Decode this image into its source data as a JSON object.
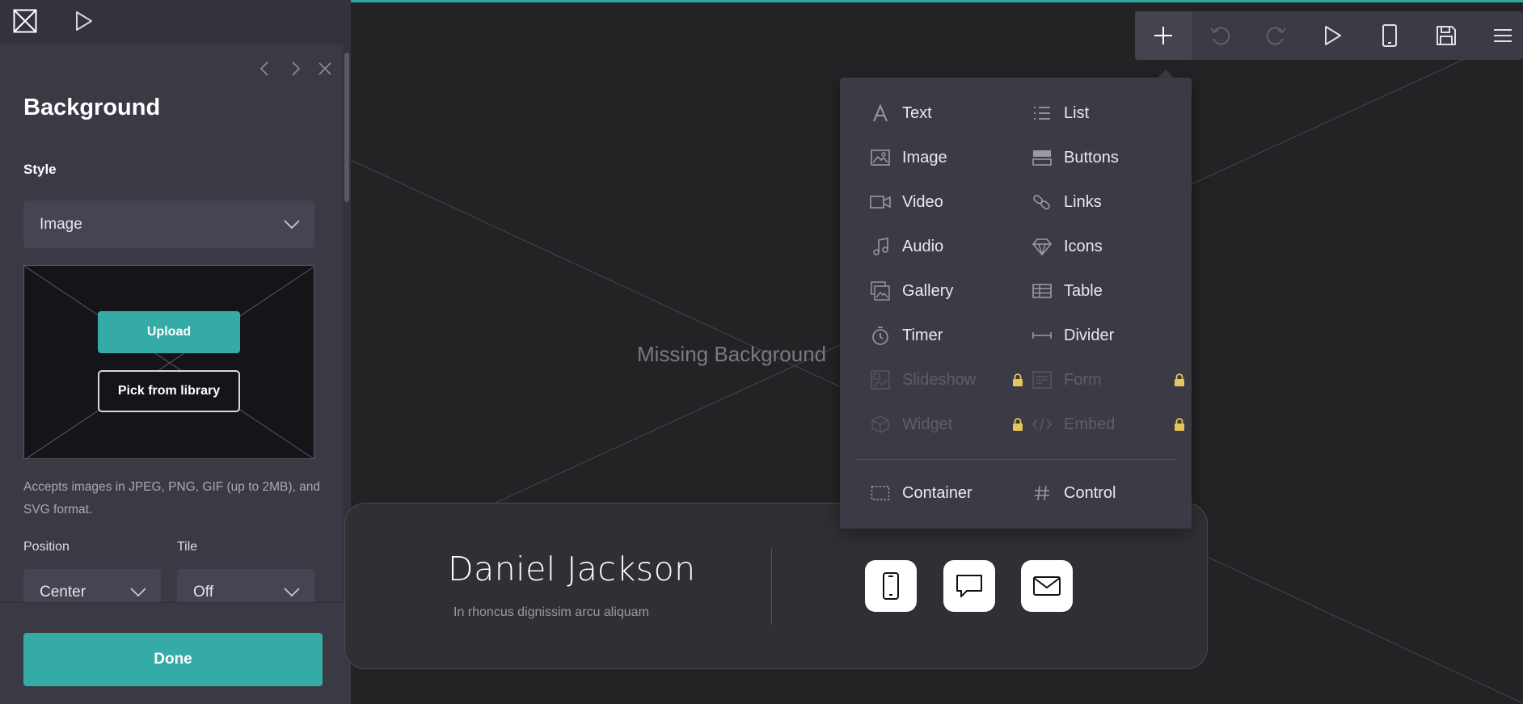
{
  "panel": {
    "title": "Background",
    "style_label": "Style",
    "style_value": "Image",
    "upload_label": "Upload",
    "library_label": "Pick from library",
    "accept_text": "Accepts images in JPEG, PNG, GIF (up to 2MB), and SVG format.",
    "position_label": "Position",
    "position_value": "Center",
    "tile_label": "Tile",
    "tile_value": "Off",
    "done_label": "Done"
  },
  "canvas": {
    "missing_text": "Missing Background",
    "profile": {
      "name": "Daniel Jackson",
      "subtitle": "In rhoncus dignissim arcu aliquam"
    }
  },
  "toolbar": {
    "buttons": [
      "plus-icon",
      "undo-icon",
      "redo-icon",
      "play-icon",
      "mobile-icon",
      "save-icon",
      "menu-icon"
    ]
  },
  "add_menu": {
    "items": [
      {
        "label": "Text",
        "icon": "text-icon",
        "locked": false
      },
      {
        "label": "List",
        "icon": "list-icon",
        "locked": false
      },
      {
        "label": "Image",
        "icon": "image-icon",
        "locked": false
      },
      {
        "label": "Buttons",
        "icon": "buttons-icon",
        "locked": false
      },
      {
        "label": "Video",
        "icon": "video-icon",
        "locked": false
      },
      {
        "label": "Links",
        "icon": "link-icon",
        "locked": false
      },
      {
        "label": "Audio",
        "icon": "music-note-icon",
        "locked": false
      },
      {
        "label": "Icons",
        "icon": "diamond-icon",
        "locked": false
      },
      {
        "label": "Gallery",
        "icon": "gallery-icon",
        "locked": false
      },
      {
        "label": "Table",
        "icon": "table-icon",
        "locked": false
      },
      {
        "label": "Timer",
        "icon": "stopwatch-icon",
        "locked": false
      },
      {
        "label": "Divider",
        "icon": "divider-icon",
        "locked": false
      },
      {
        "label": "Slideshow",
        "icon": "slideshow-icon",
        "locked": true
      },
      {
        "label": "Form",
        "icon": "form-icon",
        "locked": true
      },
      {
        "label": "Widget",
        "icon": "cube-icon",
        "locked": true
      },
      {
        "label": "Embed",
        "icon": "code-icon",
        "locked": true
      },
      {
        "label": "Container",
        "icon": "dashed-box-icon",
        "locked": false
      },
      {
        "label": "Control",
        "icon": "hash-icon",
        "locked": false
      }
    ]
  },
  "colors": {
    "accent": "#34aba6",
    "panel_bg": "#3a3a45",
    "canvas_bg": "#232326",
    "lock": "#e6c65a"
  }
}
